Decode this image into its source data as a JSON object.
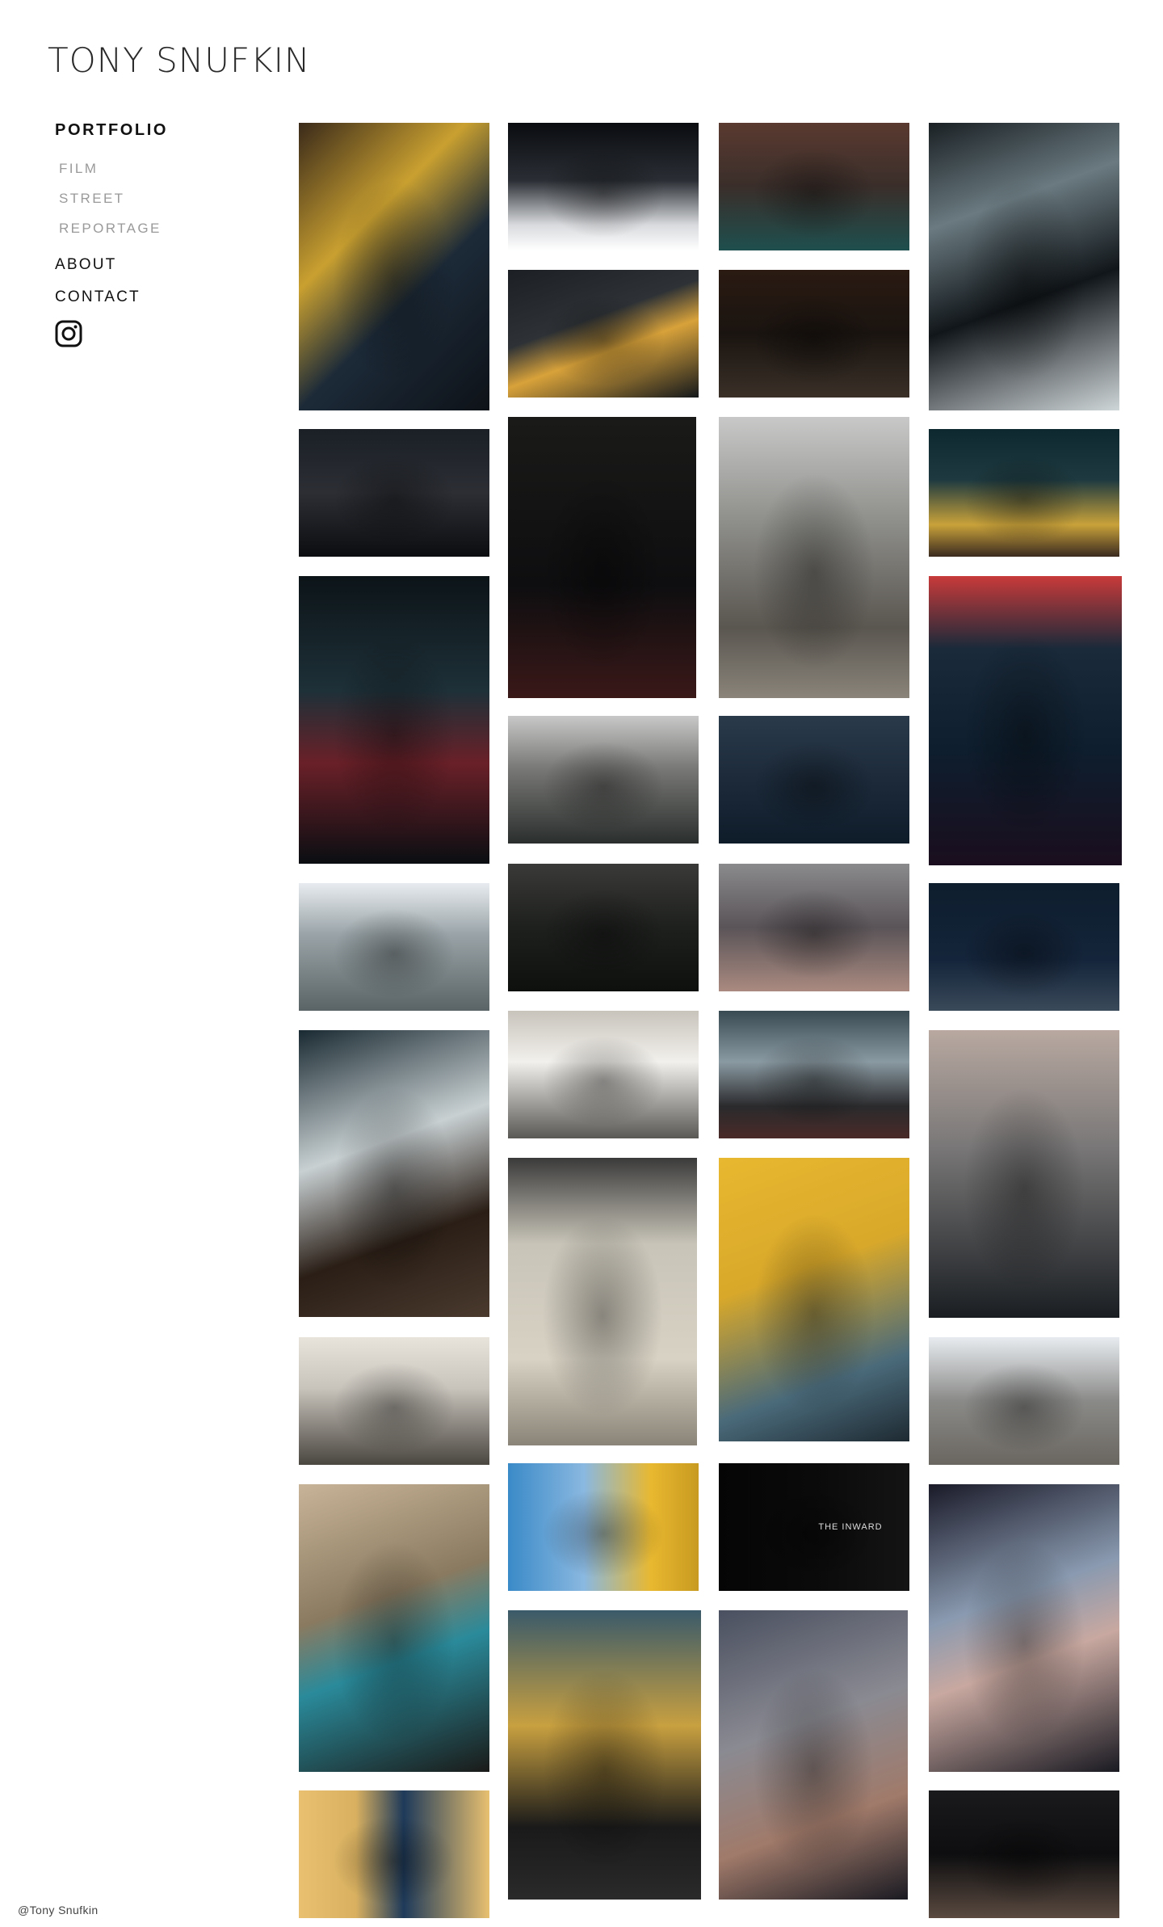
{
  "brand": {
    "name": "TONY SNUFKIN"
  },
  "nav": {
    "portfolio": "PORTFOLIO",
    "film": "FILM",
    "street": "STREET",
    "reportage": "REPORTAGE",
    "about": "ABOUT",
    "contact": "CONTACT",
    "instagram_icon": "instagram-icon"
  },
  "footer": {
    "copyright": "@Tony Snufkin"
  },
  "colors": {
    "text": "#111111",
    "muted": "#9a9a9a",
    "background": "#ffffff"
  },
  "gallery": [
    {
      "name": "photo-woman-window-yellow",
      "bg": "linear-gradient(135deg,#3a2a1a 0%,#c9a030 35%,#1c2a38 60%,#0e1218 100%)",
      "caption": ""
    },
    {
      "name": "photo-woman-counter",
      "bg": "linear-gradient(180deg,#0a0c10 0%,#2a2e34 45%,#d8dadd 80%,#ffffff 100%)",
      "caption": ""
    },
    {
      "name": "photo-man-rain-window",
      "bg": "linear-gradient(180deg,#5a3a30 0%,#3a2e2a 50%,#1e4f4e 100%)",
      "caption": ""
    },
    {
      "name": "photo-man-hat-walking",
      "bg": "linear-gradient(160deg,#1a2024 0%,#6a7a80 30%,#11161a 60%,#cfd6d8 100%)",
      "caption": ""
    },
    {
      "name": "photo-man-hat-night",
      "bg": "linear-gradient(180deg,#1a2026 0%,#2c2e34 50%,#0b0d10 100%)",
      "caption": ""
    },
    {
      "name": "photo-yellow-hat",
      "bg": "linear-gradient(160deg,#1c2024 0%,#2e3236 40%,#d8a23a 60%,#14181c 100%)",
      "caption": ""
    },
    {
      "name": "photo-dark-alley",
      "bg": "linear-gradient(180deg,#2a1a12 0%,#1a1410 50%,#3a3028 100%)",
      "caption": ""
    },
    {
      "name": "photo-taxi-rain",
      "bg": "linear-gradient(180deg,#0e2830 0%,#1e3a40 40%,#c9a23a 75%,#3a2a20 100%)",
      "caption": ""
    },
    {
      "name": "photo-umbrella-street",
      "bg": "linear-gradient(180deg,#0c1418 0%,#1e3038 40%,#6a2028 65%,#0a0e12 100%)",
      "caption": ""
    },
    {
      "name": "photo-flamingo-neon",
      "bg": "linear-gradient(180deg,#1a1a18 0%,#0e0e10 60%,#3a1818 100%)",
      "caption": ""
    },
    {
      "name": "photo-rain-glass-hand",
      "bg": "linear-gradient(180deg,#c8c8c8 0%,#8a8a86 40%,#5a5650 75%,#8a847a 100%)",
      "caption": ""
    },
    {
      "name": "photo-neon-silhouette",
      "bg": "linear-gradient(180deg,#c83a3a 0%,#1a2a3a 25%,#0e1e2e 60%,#1a0e1e 100%)",
      "caption": ""
    },
    {
      "name": "photo-traders-only",
      "bg": "linear-gradient(180deg,#c8c8c8 0%,#7a7a78 40%,#2a2e2c 100%)",
      "caption": ""
    },
    {
      "name": "photo-woman-crosswalk",
      "bg": "linear-gradient(180deg,#2a3a4a 0%,#1c2a3a 50%,#0e1c2a 100%)",
      "caption": ""
    },
    {
      "name": "photo-woman-bus-window",
      "bg": "linear-gradient(180deg,#e8ecf0 0%,#9aa4a8 40%,#5a6466 100%)",
      "caption": ""
    },
    {
      "name": "photo-stairs",
      "bg": "linear-gradient(180deg,#3a3a38 0%,#1e201e 50%,#0e100e 100%)",
      "caption": ""
    },
    {
      "name": "photo-frosted-glass",
      "bg": "linear-gradient(180deg,#8a8a8c 0%,#5a5458 50%,#aa8a80 100%)",
      "caption": ""
    },
    {
      "name": "photo-shopping-cart",
      "bg": "linear-gradient(180deg,#0e1e2e 0%,#14243a 60%,#3a4a5a 100%)",
      "caption": ""
    },
    {
      "name": "photo-man-reading",
      "bg": "linear-gradient(180deg,#c8c4bc 0%,#f2f0ec 40%,#5a5854 100%)",
      "caption": ""
    },
    {
      "name": "photo-hallway-silhouette",
      "bg": "linear-gradient(160deg,#1a2a32 0%,#c8d0d2 40%,#2a1e16 70%,#4a3a2e 100%)",
      "caption": ""
    },
    {
      "name": "photo-woman-station",
      "bg": "linear-gradient(180deg,#3a4a52 0%,#8a9aa2 40%,#2a2a2c 75%,#4a2a28 100%)",
      "caption": ""
    },
    {
      "name": "photo-old-man-hat",
      "bg": "linear-gradient(180deg,#b8a8a0 0%,#7a7878 40%,#1a1e22 100%)",
      "caption": ""
    },
    {
      "name": "photo-newspaper-stacks",
      "bg": "linear-gradient(180deg,#3a3a3a 0%,#c8c4b8 30%,#d8d2c4 70%,#8a8478 100%)",
      "caption": ""
    },
    {
      "name": "photo-inquirer-tram",
      "bg": "linear-gradient(160deg,#e8b830 0%,#d8a82a 40%,#4a6a7a 75%,#1e2a32 100%)",
      "caption": ""
    },
    {
      "name": "photo-mall-corridor",
      "bg": "linear-gradient(180deg,#e8e4dc 0%,#c8c4bc 40%,#4a4640 100%)",
      "caption": ""
    },
    {
      "name": "photo-steps-walkers",
      "bg": "linear-gradient(180deg,#e8ecf0 0%,#8a8a88 50%,#6a6660 100%)",
      "caption": ""
    },
    {
      "name": "photo-curtain-sea",
      "bg": "linear-gradient(160deg,#c8b498 0%,#8a7a60 40%,#2a8a9a 60%,#1a1a18 100%)",
      "caption": ""
    },
    {
      "name": "photo-boy-yellow-train",
      "bg": "linear-gradient(90deg,#3a8ac8 0%,#8ab8e0 40%,#e8b830 75%,#c89a20 100%)",
      "caption": ""
    },
    {
      "name": "photo-the-inward",
      "bg": "linear-gradient(90deg,#050505 0%,#0a0a0a 50%,#141414 100%)",
      "caption": "THE INWARD"
    },
    {
      "name": "photo-blurred-hat-man",
      "bg": "linear-gradient(160deg,#1a1a28 0%,#8a9ab0 40%,#c8a8a0 60%,#1a1a22 100%)",
      "caption": ""
    },
    {
      "name": "photo-man-pole",
      "bg": "linear-gradient(180deg,#3a5a6a 0%,#c8a040 40%,#1a1a1a 75%,#2a2a2a 100%)",
      "caption": ""
    },
    {
      "name": "photo-long-hair-mannequin",
      "bg": "linear-gradient(160deg,#4a5060 0%,#8a8a92 40%,#a07a6a 70%,#1a1a22 100%)",
      "caption": ""
    },
    {
      "name": "photo-mirror-old-men",
      "bg": "linear-gradient(90deg,#e8c070 0%,#d8b060 30%,#1e3a5a 55%,#e8c070 100%)",
      "caption": ""
    },
    {
      "name": "photo-walking-feet",
      "bg": "linear-gradient(180deg,#1a1a1c 0%,#0e0e10 50%,#5a4a40 100%)",
      "caption": ""
    }
  ]
}
